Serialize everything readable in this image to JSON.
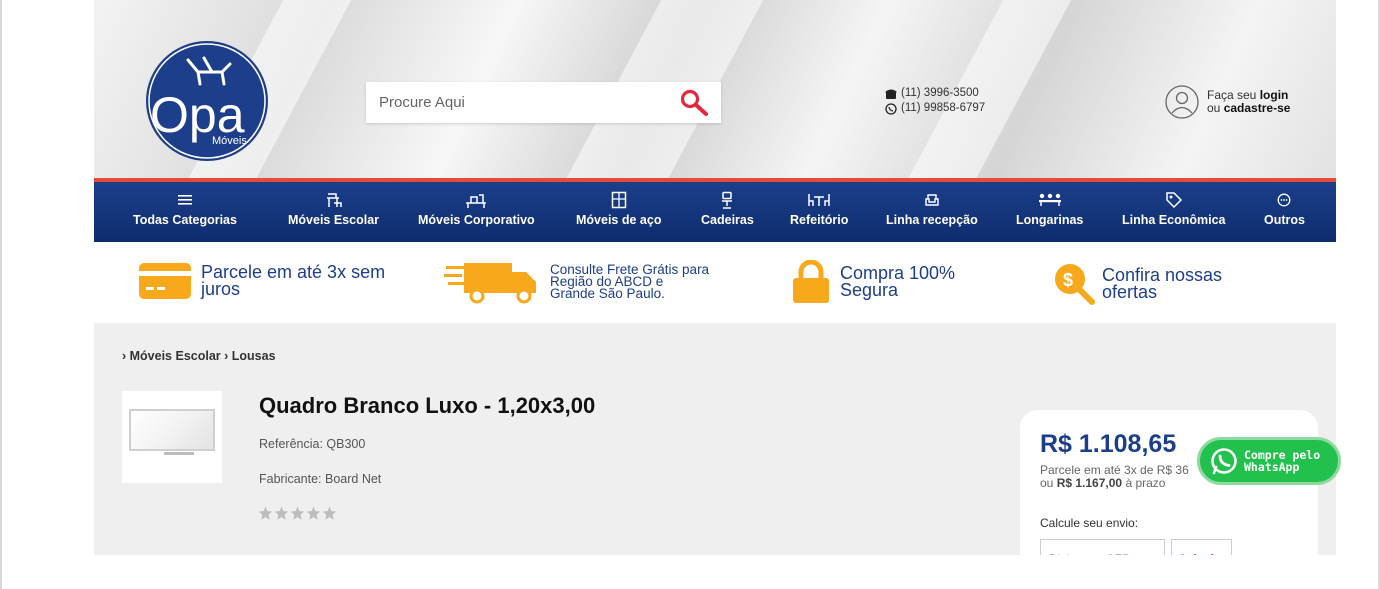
{
  "header": {
    "logo": {
      "brand": "Opa",
      "sub": "Móveis"
    },
    "search": {
      "placeholder": "Procure Aqui"
    },
    "phones": [
      "(11) 3996-3500",
      "(11) 99858-6797"
    ],
    "account": {
      "prefix": "Faça seu",
      "login": "login",
      "middle": "ou",
      "signup": "cadastre-se"
    }
  },
  "nav": [
    {
      "label": "Todas Categorias",
      "icon": "menu-icon"
    },
    {
      "label": "Móveis Escolar",
      "icon": "school-desk-icon"
    },
    {
      "label": "Móveis Corporativo",
      "icon": "office-desk-icon"
    },
    {
      "label": "Móveis de aço",
      "icon": "steel-cabinet-icon"
    },
    {
      "label": "Cadeiras",
      "icon": "chair-icon"
    },
    {
      "label": "Refeitório",
      "icon": "dining-table-icon"
    },
    {
      "label": "Linha recepção",
      "icon": "armchair-icon"
    },
    {
      "label": "Longarinas",
      "icon": "bench-seat-icon"
    },
    {
      "label": "Linha Econômica",
      "icon": "price-tag-icon"
    },
    {
      "label": "Outros",
      "icon": "more-icon"
    }
  ],
  "benefits": [
    {
      "text": "Parcele em até 3x sem juros",
      "icon": "credit-card-icon"
    },
    {
      "text": "Consulte Frete Grátis para Região do ABCD e Grande São Paulo.",
      "icon": "delivery-truck-icon"
    },
    {
      "text": "Compra 100% Segura",
      "icon": "padlock-icon"
    },
    {
      "text": "Confira nossas ofertas",
      "icon": "offer-search-icon"
    }
  ],
  "breadcrumb": "› Móveis Escolar › Lousas",
  "product": {
    "title": "Quadro Branco Luxo - 1,20x3,00",
    "reference": "Referência: QB300",
    "manufacturer": "Fabricante: Board Net",
    "rating": 0
  },
  "price": {
    "value": "R$ 1.108,65",
    "installments": "Parcele em até 3x de R$ 36",
    "or": "ou",
    "term_price": "R$ 1.167,00",
    "term_suffix": "à prazo",
    "shipping_label": "Calcule seu envio:",
    "cep_placeholder": "Digite seu CEP",
    "calc_button": "Calcular"
  },
  "whatsapp": {
    "line1": "Compre pelo",
    "line2": "WhatsApp"
  },
  "colors": {
    "brand_blue": "#1d3e8a",
    "nav_blue": "#163a84",
    "accent_red": "#e84a3a",
    "orange": "#f7a81b",
    "whatsapp_green": "#22c14e"
  }
}
